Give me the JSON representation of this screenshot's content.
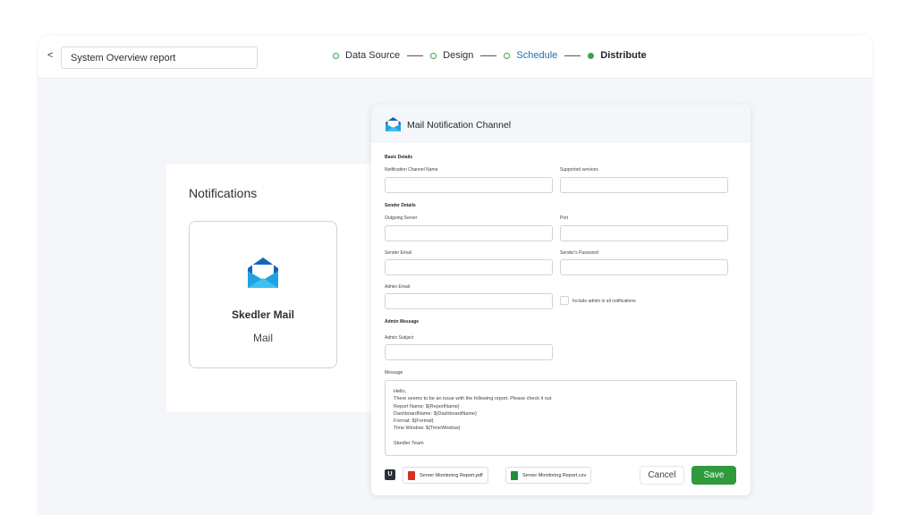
{
  "header": {
    "back_label": "<",
    "report_name": "System Overview report",
    "steps": [
      {
        "label": "Data Source",
        "active": false
      },
      {
        "label": "Design",
        "active": false
      },
      {
        "label": "Schedule",
        "active": false
      },
      {
        "label": "Distribute",
        "active": true
      }
    ]
  },
  "notifications": {
    "title": "Notifications",
    "channel_name": "Skedler Mail",
    "channel_type": "Mail",
    "icon": "mail-envelope-icon"
  },
  "modal": {
    "title": "Mail Notification Channel",
    "basic_details": "Basic Details",
    "channel_name_label": "Notification Channel Name",
    "supported_services_label": "Supported services",
    "sender_details": "Sender Details",
    "outgoing_server_label": "Outgoing Server",
    "port_label": "Port",
    "sender_email_label": "Sender Email",
    "sender_password_label": "Sender's Password",
    "admin_email_label": "Admin Email",
    "include_admin_label": "Include admin in all notifications",
    "admin_message": "Admin Message",
    "admin_subject_label": "Admin Subject",
    "message_label": "Message",
    "message_lines": [
      "Hello,",
      "There seems to be an issue with the following report. Please check it out",
      "Report Name: ${ReportName}",
      "DashboardName: ${DashboardName}",
      "Format: ${Format}",
      "Time Window: ${TimeWindow}",
      "",
      "Skedler Team"
    ],
    "attachments": [
      {
        "name": "Server Monitoring Report.pdf",
        "color": "#d93025"
      },
      {
        "name": "Server Monitoring Report.csv",
        "color": "#1e8e3e"
      }
    ],
    "cancel_label": "Cancel",
    "save_label": "Save"
  },
  "colors": {
    "accent_green": "#2f9b3d",
    "mail_blue": "#1b8fd6"
  }
}
